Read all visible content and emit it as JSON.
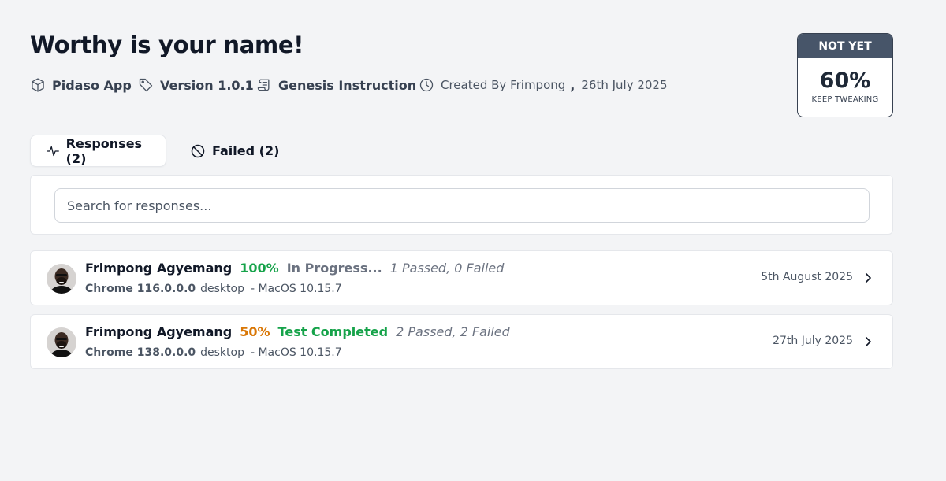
{
  "header": {
    "title": "Worthy is your name!",
    "app": {
      "label": "Pidaso App",
      "icon": "cube-icon"
    },
    "version": {
      "label": "Version 1.0.1",
      "icon": "tag-icon"
    },
    "instruction": {
      "label": "Genesis Instruction",
      "icon": "scroll-icon"
    },
    "created": {
      "label": "Created By Frimpong",
      "separator": ",",
      "date": "26th July 2025",
      "icon": "clock-icon"
    }
  },
  "score": {
    "status": "NOT YET",
    "percent": "60%",
    "message": "KEEP TWEAKING"
  },
  "tabs": [
    {
      "label": "Responses (2)",
      "icon": "activity-icon",
      "active": true
    },
    {
      "label": "Failed (2)",
      "icon": "ban-icon",
      "active": false
    }
  ],
  "search": {
    "placeholder": "Search for responses..."
  },
  "responses": [
    {
      "name": "Frimpong Agyemang",
      "percent": "100%",
      "percent_color": "#16a34a",
      "status": "In Progress...",
      "status_color": "#6b7280",
      "counts": "1 Passed, 0 Failed",
      "browser": "Chrome 116.0.0.0",
      "device": "desktop",
      "os": "- MacOS 10.15.7",
      "date": "5th August 2025"
    },
    {
      "name": "Frimpong Agyemang",
      "percent": "50%",
      "percent_color": "#d97706",
      "status": "Test Completed",
      "status_color": "#16a34a",
      "counts": "2 Passed, 2 Failed",
      "browser": "Chrome 138.0.0.0",
      "device": "desktop",
      "os": "- MacOS 10.15.7",
      "date": "27th July 2025"
    }
  ]
}
